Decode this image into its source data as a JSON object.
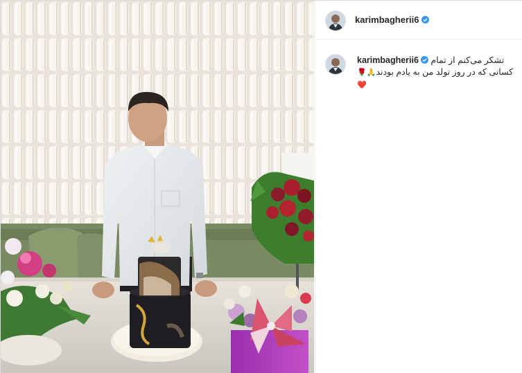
{
  "post": {
    "username": "karimbagherii6",
    "verified": true,
    "caption_line1": "تشکر می‌کنم از تمام",
    "caption_line2": "کسانی که در روز تولد من به یادم بودند",
    "caption_emoji_line2": "🙏🌹",
    "caption_emoji_line3": "❤️"
  },
  "colors": {
    "verified_badge": "#3897f0",
    "text": "#262626",
    "heart": "#ed4956"
  },
  "icons": {
    "verified": "verified-badge-icon",
    "avatar": "profile-avatar"
  }
}
